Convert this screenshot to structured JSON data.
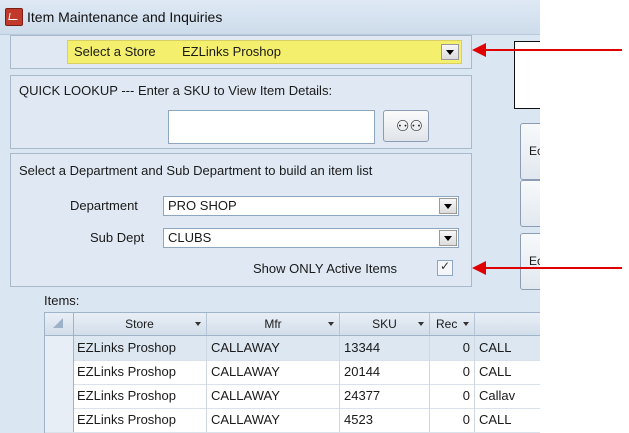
{
  "window": {
    "title": "Item Maintenance and Inquiries"
  },
  "store": {
    "label": "Select a Store",
    "value": "EZLinks Proshop"
  },
  "quick_lookup": {
    "title": "QUICK LOOKUP --- Enter a SKU to View Item Details:",
    "sku_value": ""
  },
  "dept_panel": {
    "title": "Select a Department and Sub Department to build an item list",
    "department_label": "Department",
    "department_value": "PRO SHOP",
    "subdept_label": "Sub Dept",
    "subdept_value": "CLUBS",
    "active_label": "Show ONLY Active Items",
    "active_checked": true
  },
  "right_buttons": [
    "Ec",
    "",
    "Ec"
  ],
  "items": {
    "label": "Items:",
    "columns": [
      "Store",
      "Mfr",
      "SKU",
      "Rec"
    ],
    "rows": [
      [
        "EZLinks Proshop",
        "CALLAWAY",
        "13344",
        "0",
        "CALL"
      ],
      [
        "EZLinks Proshop",
        "CALLAWAY",
        "20144",
        "0",
        "CALL"
      ],
      [
        "EZLinks Proshop",
        "CALLAWAY",
        "24377",
        "0",
        "Callav"
      ],
      [
        "EZLinks Proshop",
        "CALLAWAY",
        "4523",
        "0",
        "CALL"
      ]
    ]
  },
  "colors": {
    "annotation_arrow": "#e00000",
    "store_highlight": "#f5ef6e"
  }
}
